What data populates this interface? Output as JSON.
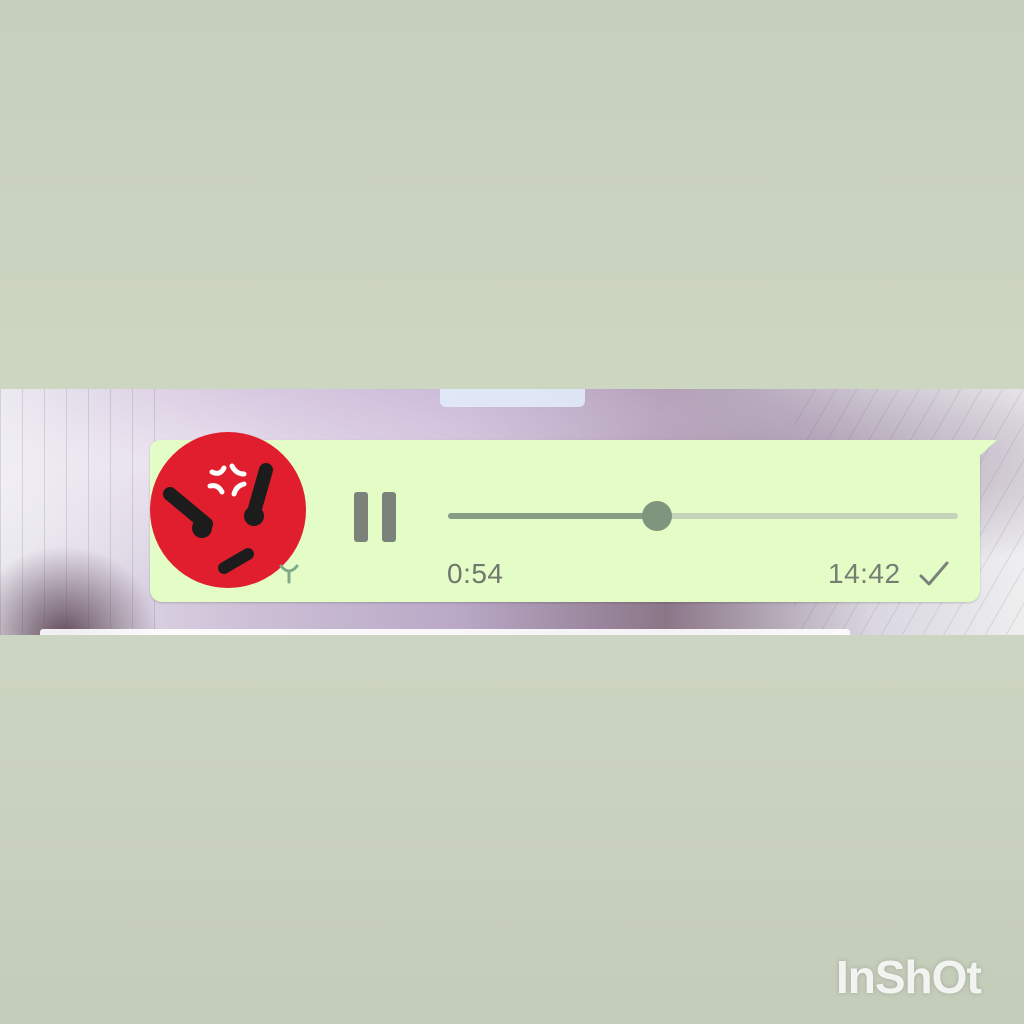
{
  "voice_message": {
    "elapsed": "0:54",
    "timestamp": "14:42",
    "status_icon": "single-check-icon",
    "playback_state": "playing",
    "control_icon": "pause-icon",
    "progress_fraction": 0.41,
    "avatar_icon": "angry-emoji-icon",
    "mic_icon": "microphone-icon"
  },
  "watermark": {
    "text": "InShOt"
  },
  "colors": {
    "bubble": "#e4fdc6",
    "avatar": "#e01e2d",
    "seek_fill": "#869c84",
    "seek_track": "#c4d3b7",
    "text": "#6f776e"
  }
}
